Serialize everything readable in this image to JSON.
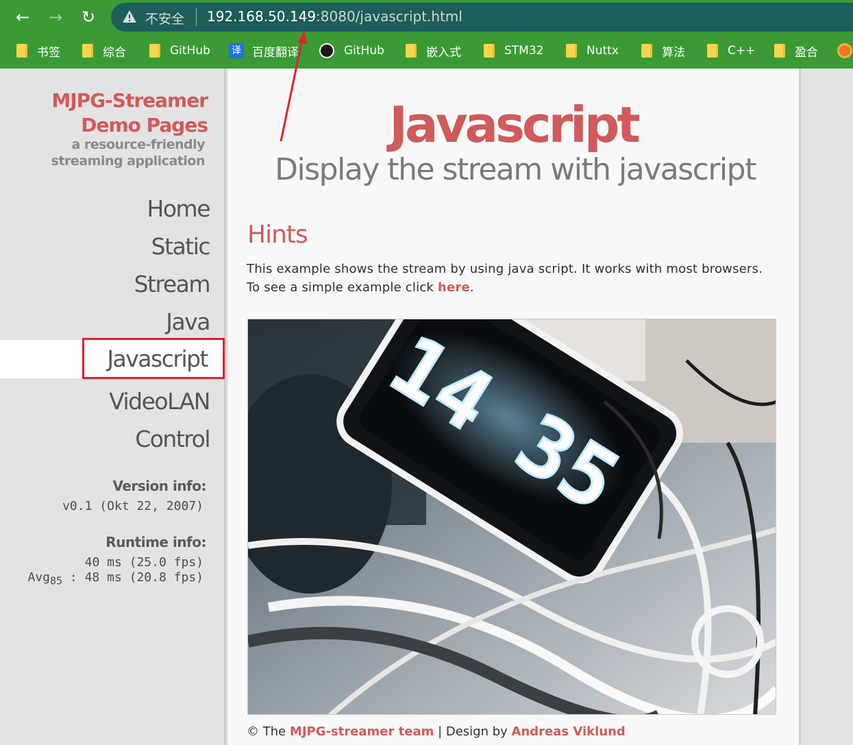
{
  "browser": {
    "nav": {
      "back_icon": "←",
      "forward_icon": "→",
      "reload_icon": "↻"
    },
    "security_label": "不安全",
    "url_host": "192.168.50.149",
    "url_rest": ":8080/javascript.html",
    "bookmarks": [
      {
        "label": "书签",
        "icon": "folder-icon"
      },
      {
        "label": "综合",
        "icon": "folder-icon"
      },
      {
        "label": "GitHub",
        "icon": "folder-icon"
      },
      {
        "label": "百度翻译",
        "icon": "fanyi-icon",
        "icon_text": "译"
      },
      {
        "label": "GitHub",
        "icon": "github-icon"
      },
      {
        "label": "嵌入式",
        "icon": "folder-icon"
      },
      {
        "label": "STM32",
        "icon": "folder-icon"
      },
      {
        "label": "Nuttx",
        "icon": "folder-icon"
      },
      {
        "label": "算法",
        "icon": "folder-icon"
      },
      {
        "label": "C++",
        "icon": "folder-icon"
      },
      {
        "label": "盈合",
        "icon": "folder-icon"
      }
    ],
    "colors": {
      "chrome_green": "#3b9a36",
      "omnibox": "#1d5d5a"
    }
  },
  "sidebar": {
    "logo_line1": "MJPG-Streamer",
    "logo_line2": "Demo Pages",
    "tagline_line1": "a resource-friendly",
    "tagline_line2": "streaming application",
    "nav": [
      "Home",
      "Static",
      "Stream",
      "Java",
      "Javascript",
      "VideoLAN",
      "Control"
    ],
    "active_nav": "Javascript",
    "version_heading": "Version info:",
    "version_text": "v0.1 (Okt 22, 2007)",
    "runtime_heading": "Runtime info:",
    "runtime_line1": "40 ms (25.0 fps)",
    "runtime_avg_label": "Avg",
    "runtime_avg_sub": "85",
    "runtime_line2": ": 48 ms (20.8 fps)"
  },
  "main": {
    "title": "Javascript",
    "subtitle": "Display the stream with javascript",
    "hints_heading": "Hints",
    "para1": "This example shows the stream by using java script. It works with most browsers.",
    "para2_before": "To see a simple example click ",
    "para2_link": "here",
    "para2_after": ".",
    "stream_clock_text": "14 35",
    "footer_before": "© The ",
    "footer_team": "MJPG-streamer team",
    "footer_mid": " | Design by ",
    "footer_author": "Andreas Viklund"
  },
  "colors": {
    "accent": "#d15a5a",
    "annotation": "#e0212e"
  }
}
